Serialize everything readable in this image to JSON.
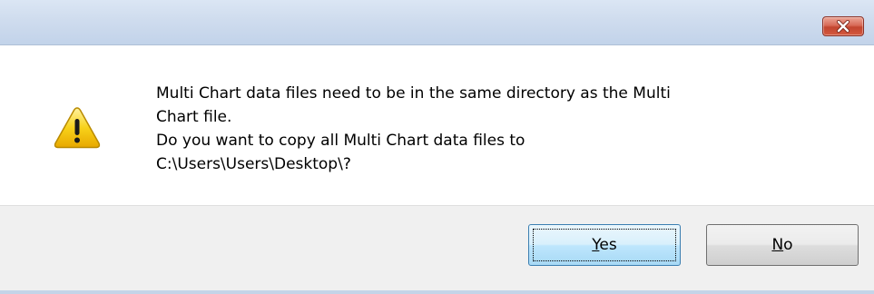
{
  "titlebar": {
    "close_icon": "close-icon"
  },
  "message": {
    "icon": "warning-icon",
    "lines": [
      "Multi Chart data files need to be in the same directory as the Multi",
      "Chart file.",
      "Do you want to copy all Multi Chart data files to",
      "C:\\Users\\Users\\Desktop\\?"
    ]
  },
  "buttons": {
    "yes": {
      "mnemonic": "Y",
      "rest": "es"
    },
    "no": {
      "mnemonic": "N",
      "rest": "o"
    }
  },
  "colors": {
    "close_button": "#c2452f",
    "warning": "#f5c400",
    "focus_button_border": "#3c7fb1"
  }
}
